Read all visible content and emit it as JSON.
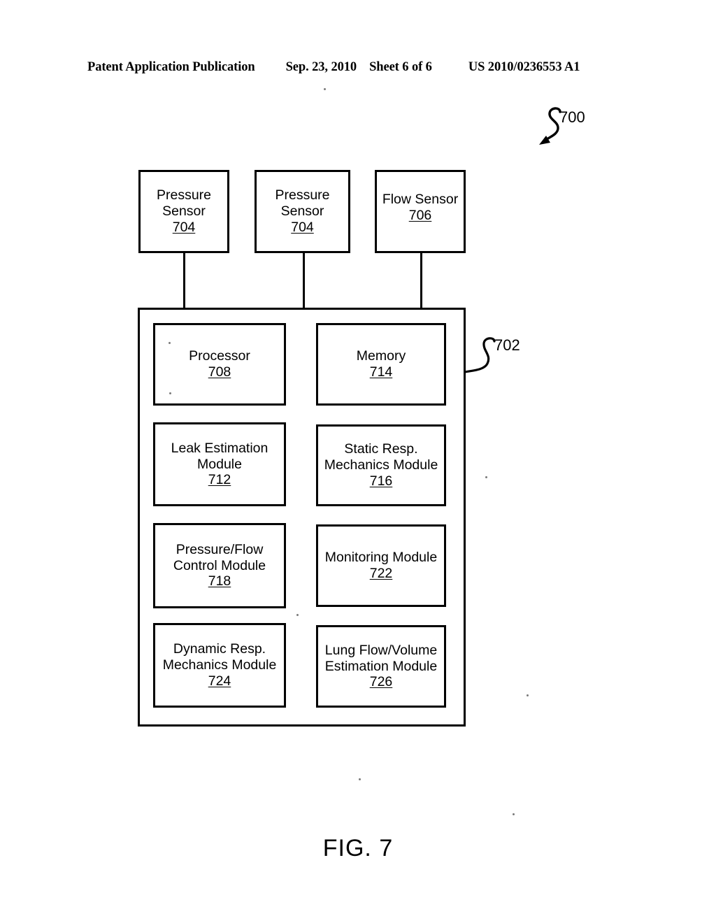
{
  "header": {
    "publication": "Patent Application Publication",
    "date": "Sep. 23, 2010",
    "sheet": "Sheet 6 of 6",
    "number": "US 2010/0236553 A1"
  },
  "figure": {
    "caption": "FIG. 7",
    "system_callout": "700",
    "controller_callout": "702"
  },
  "sensors": [
    {
      "line1": "Pressure",
      "line2": "Sensor",
      "ref": "704"
    },
    {
      "line1": "Pressure",
      "line2": "Sensor",
      "ref": "704"
    },
    {
      "line1": "Flow Sensor",
      "line2": "",
      "ref": "706"
    }
  ],
  "modules_left": [
    {
      "line1": "Processor",
      "line2": "",
      "ref": "708"
    },
    {
      "line1": "Leak Estimation",
      "line2": "Module",
      "ref": "712"
    },
    {
      "line1": "Pressure/Flow",
      "line2": "Control Module",
      "ref": "718"
    },
    {
      "line1": "Dynamic Resp.",
      "line2": "Mechanics Module",
      "ref": "724"
    }
  ],
  "modules_right": [
    {
      "line1": "Memory",
      "line2": "",
      "ref": "714"
    },
    {
      "line1": "Static Resp.",
      "line2": "Mechanics Module",
      "ref": "716"
    },
    {
      "line1": "Monitoring Module",
      "line2": "",
      "ref": "722"
    },
    {
      "line1": "Lung Flow/Volume",
      "line2": "Estimation Module",
      "ref": "726"
    }
  ]
}
